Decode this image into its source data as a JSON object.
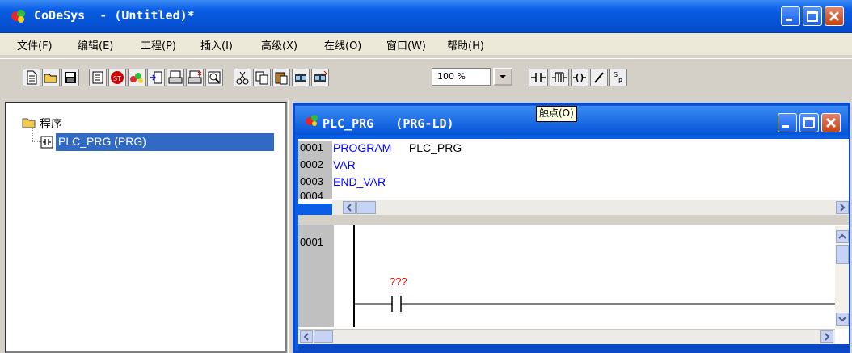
{
  "window": {
    "title": "CoDeSys  - (Untitled)*"
  },
  "menu": [
    "文件(F)",
    "编辑(E)",
    "工程(P)",
    "插入(I)",
    "高级(X)",
    "在线(O)",
    "窗口(W)",
    "帮助(H)"
  ],
  "toolbar": {
    "zoom_value": "100 %"
  },
  "tooltip": "触点(O)",
  "tree": {
    "root": "程序",
    "item": "PLC_PRG (PRG)"
  },
  "editor": {
    "title": "PLC_PRG   (PRG-LD)",
    "decl_lines": [
      {
        "num": "0001",
        "kw": "PROGRAM",
        "rest": " PLC_PRG"
      },
      {
        "num": "0002",
        "kw": "VAR",
        "rest": ""
      },
      {
        "num": "0003",
        "kw": "END_VAR",
        "rest": ""
      },
      {
        "num": "0004",
        "kw": "",
        "rest": ""
      }
    ],
    "network_num": "0001",
    "contact_label": "???"
  },
  "colors": {
    "titlebar": "#0553d6",
    "selection": "#316ac5",
    "keyword": "#0000ff",
    "contact_label": "#ff0000"
  }
}
